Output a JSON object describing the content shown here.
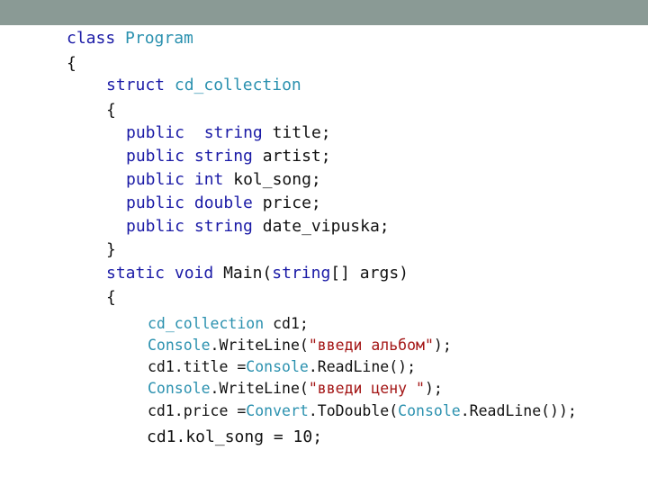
{
  "colors": {
    "keyword": "#1a1aa6",
    "type": "#2b91af",
    "string": "#a31515",
    "text": "#111111",
    "top_bar": "#8a9a95"
  },
  "code": {
    "line1": {
      "kw": "class",
      "ty": "Program"
    },
    "line2": {
      "text": "{"
    },
    "line3": {
      "kw": "struct",
      "ty": "cd_collection"
    },
    "line4": {
      "text": "{"
    },
    "line5": {
      "kw1": "public",
      "kw2": "string",
      "rest": "title;"
    },
    "line6": {
      "kw1": "public",
      "kw2": "string",
      "rest": "artist;"
    },
    "line7": {
      "kw1": "public",
      "kw2": "int",
      "rest": "kol_song;"
    },
    "line8": {
      "kw1": "public",
      "kw2": "double",
      "rest": "price;"
    },
    "line9": {
      "kw1": "public",
      "kw2": "string",
      "rest": "date_vipuska;"
    },
    "line10": {
      "text": "}"
    },
    "line11": {
      "kw1": "static",
      "kw2": "void",
      "name": "Main(",
      "kw3": "string",
      "rest": "[] args)"
    },
    "line12": {
      "text": "{"
    },
    "line13": {
      "ty": "cd_collection",
      "rest": " cd1;"
    },
    "line14": {
      "ty": "Console",
      "mid": ".WriteLine(",
      "str": "\"введи альбом\"",
      "end": ");"
    },
    "line15": {
      "pre": "cd1.title =",
      "ty": "Console",
      "end": ".ReadLine();"
    },
    "line16": {
      "ty": "Console",
      "mid": ".WriteLine(",
      "str": "\"введи цену \"",
      "end": ");"
    },
    "line17": {
      "pre": "cd1.price =",
      "ty1": "Convert",
      "mid": ".ToDouble(",
      "ty2": "Console",
      "end": ".ReadLine());"
    },
    "line18": {
      "text": "cd1.kol_song = 10;"
    }
  }
}
